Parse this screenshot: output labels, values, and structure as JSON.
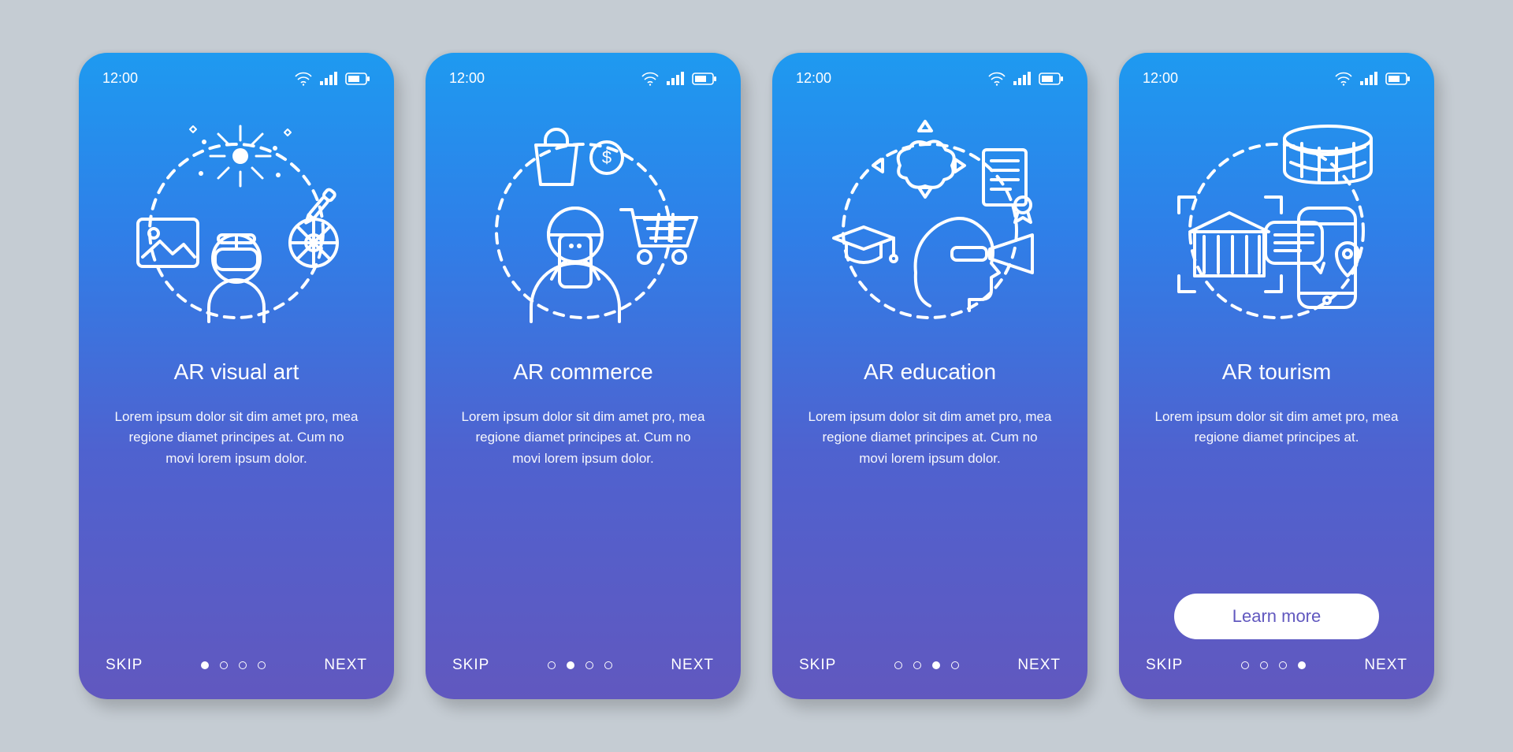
{
  "status": {
    "time": "12:00",
    "icons": {
      "wifi": "wifi-icon",
      "signal": "signal-icon",
      "battery": "battery-icon"
    }
  },
  "nav": {
    "skip": "SKIP",
    "next": "NEXT"
  },
  "cta_label": "Learn more",
  "body_text": "Lorem ipsum dolor sit dim amet pro, mea regione diamet principes at. Cum no movi lorem ipsum dolor.",
  "body_text_short": "Lorem ipsum dolor sit dim amet pro, mea regione diamet principes at.",
  "screens": [
    {
      "title": "AR visual art",
      "active_dot": 0,
      "has_cta": false,
      "body_ref": "body_text"
    },
    {
      "title": "AR commerce",
      "active_dot": 1,
      "has_cta": false,
      "body_ref": "body_text"
    },
    {
      "title": "AR education",
      "active_dot": 2,
      "has_cta": false,
      "body_ref": "body_text"
    },
    {
      "title": "AR tourism",
      "active_dot": 3,
      "has_cta": true,
      "body_ref": "body_text_short"
    }
  ],
  "dot_count": 4,
  "illustration_names": [
    "ar-visual-art-illustration",
    "ar-commerce-illustration",
    "ar-education-illustration",
    "ar-tourism-illustration"
  ]
}
